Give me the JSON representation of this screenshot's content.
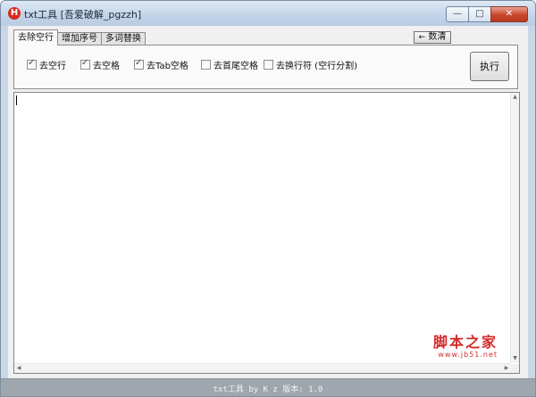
{
  "window": {
    "title": "txt工具 [吾爱破解_pgzzh]",
    "app_icon_glyph": "H",
    "minimize_glyph": "—",
    "maximize_glyph": "□",
    "close_glyph": "✕"
  },
  "tabs": [
    {
      "label": "去除空行"
    },
    {
      "label": "增加序号"
    },
    {
      "label": "多词替换"
    }
  ],
  "count_button": {
    "arrow": "←",
    "label": "数清"
  },
  "options": [
    {
      "label": "去空行",
      "checked": true
    },
    {
      "label": "去空格",
      "checked": true
    },
    {
      "label": "去Tab空格",
      "checked": true
    },
    {
      "label": "去首尾空格",
      "checked": false
    },
    {
      "label": "去换行符 (空行分割)",
      "checked": false
    }
  ],
  "execute_button": {
    "label": "执行"
  },
  "editor": {
    "value": ""
  },
  "watermark": {
    "big": "脚本之家",
    "small": "www.jb51.net"
  },
  "status": {
    "text": "txt工具 by K z  版本: 1.0"
  },
  "colors": {
    "close_button": "#c9462c",
    "watermark": "#d32a2a",
    "statusbar": "#9fa6ae"
  }
}
